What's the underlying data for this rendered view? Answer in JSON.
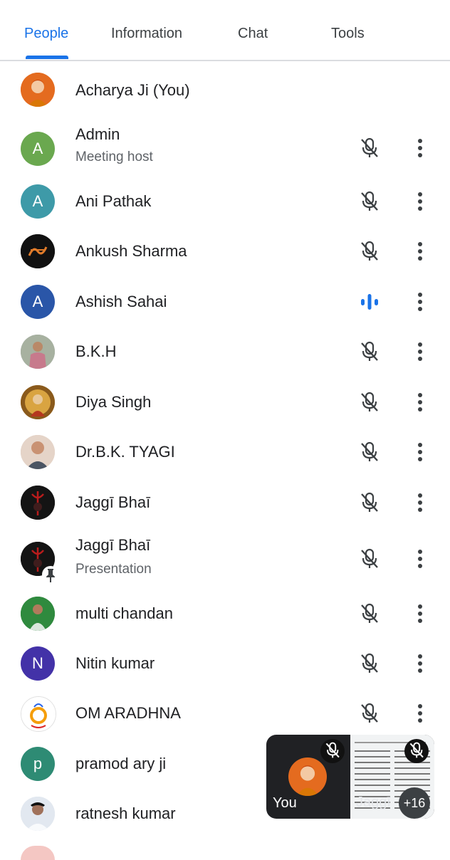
{
  "tabs": [
    {
      "label": "People",
      "active": true
    },
    {
      "label": "Information",
      "active": false
    },
    {
      "label": "Chat",
      "active": false
    },
    {
      "label": "Tools",
      "active": false
    }
  ],
  "colors": {
    "accent": "#1a73e8",
    "muted_icon": "#3c4043",
    "speaking": "#1a73e8"
  },
  "participants": [
    {
      "name": "Acharya Ji (You)",
      "avatar": "photo",
      "mic": "none"
    },
    {
      "name": "Admin",
      "subtitle": "Meeting host",
      "avatar_letter": "A",
      "avatar_color": "#6aa84f",
      "mic": "muted"
    },
    {
      "name": "Ani Pathak",
      "avatar_letter": "A",
      "avatar_color": "#3e9aa8",
      "mic": "muted"
    },
    {
      "name": "Ankush Sharma",
      "avatar": "photo",
      "mic": "muted"
    },
    {
      "name": "Ashish Sahai",
      "avatar_letter": "A",
      "avatar_color": "#2a56a8",
      "mic": "speaking"
    },
    {
      "name": "B.K.H",
      "avatar": "photo",
      "mic": "muted"
    },
    {
      "name": "Diya Singh",
      "avatar": "photo",
      "mic": "muted"
    },
    {
      "name": "Dr.B.K. TYAGI",
      "avatar": "photo",
      "mic": "muted"
    },
    {
      "name": "Jaggī Bhaī",
      "avatar": "photo",
      "mic": "muted"
    },
    {
      "name": "Jaggī Bhaī",
      "subtitle": "Presentation",
      "avatar": "photo",
      "pinned": true,
      "mic": "muted"
    },
    {
      "name": "multi chandan",
      "avatar": "photo",
      "mic": "muted"
    },
    {
      "name": "Nitin kumar",
      "avatar_letter": "N",
      "avatar_color": "#4332a8",
      "mic": "muted"
    },
    {
      "name": "OM ARADHNA",
      "avatar": "photo",
      "mic": "muted"
    },
    {
      "name": "pramod ary ji",
      "avatar_letter": "p",
      "avatar_color": "#2e8b74",
      "mic": "none"
    },
    {
      "name": "ratnesh kumar",
      "avatar": "photo",
      "mic": "none"
    }
  ],
  "pip": {
    "you_label": "You",
    "other_label": "Jaggī",
    "extra_count": "+16"
  }
}
